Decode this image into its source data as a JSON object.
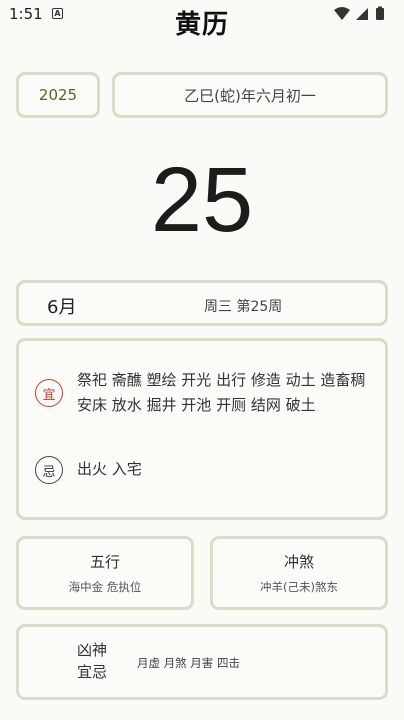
{
  "status_bar": {
    "time": "1:51",
    "notification_icon": "A"
  },
  "app": {
    "title": "黄历"
  },
  "header": {
    "year": "2025",
    "lunar_date": "乙巳(蛇)年六月初一"
  },
  "day": {
    "number": "25"
  },
  "month_row": {
    "month": "6月",
    "week_info": "周三 第25周"
  },
  "yi_ji": {
    "yi_badge": "宜",
    "yi_items": "祭祀 斋醮 塑绘 开光 出行 修造 动土 造畜稠 安床 放水 掘井 开池 开厕 结网 破土",
    "ji_badge": "忌",
    "ji_items": "出火 入宅"
  },
  "wuxing": {
    "title": "五行",
    "value": "海中金 危执位"
  },
  "chongsha": {
    "title": "冲煞",
    "value": "冲羊(己未)煞东"
  },
  "xiongshen": {
    "title_line1": "凶神",
    "title_line2": "宜忌",
    "value": "月虚 月煞 月害 四击"
  },
  "colors": {
    "card_border": "#d9dcc7",
    "year_text": "#5a6322",
    "yi_red": "#c63b2f"
  }
}
